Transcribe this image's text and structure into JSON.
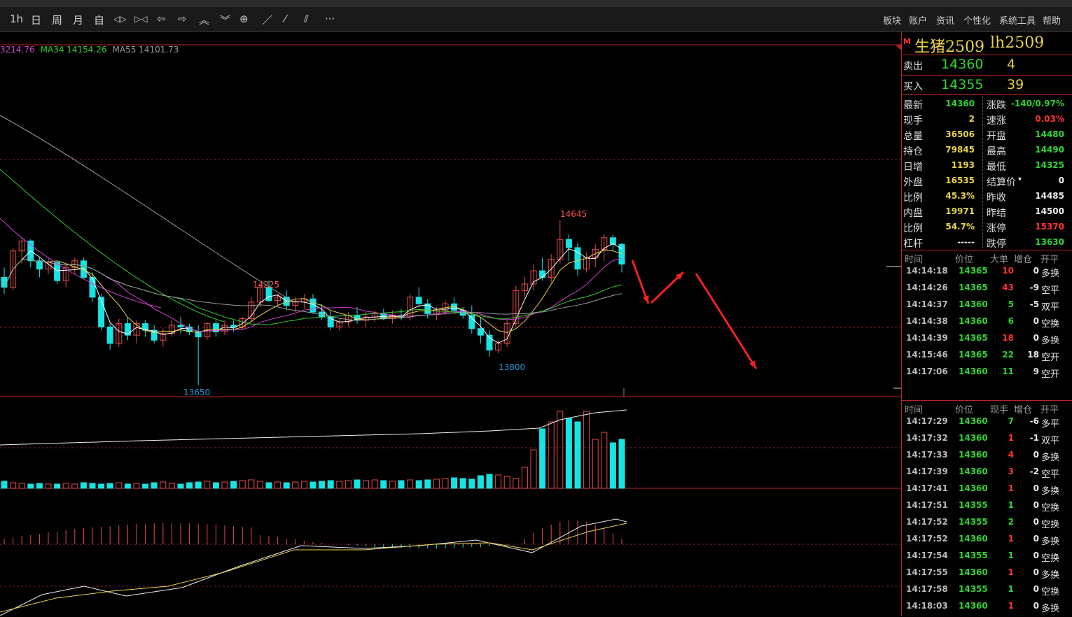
{
  "toolbar": {
    "buttons": [
      {
        "name": "period-1h-button",
        "label": "1h"
      },
      {
        "name": "period-day-button",
        "label": "日"
      },
      {
        "name": "period-week-button",
        "label": "周"
      },
      {
        "name": "period-month-button",
        "label": "月"
      },
      {
        "name": "custom-button",
        "label": "自"
      },
      {
        "name": "zoom-in-icon",
        "label": "◁▷"
      },
      {
        "name": "zoom-out-icon",
        "label": "▷◁"
      },
      {
        "name": "arrow-left-icon",
        "label": "⇦"
      },
      {
        "name": "arrow-right-icon",
        "label": "⇨"
      },
      {
        "name": "arrow-up-icon",
        "label": "︽"
      },
      {
        "name": "arrow-down-icon",
        "label": "︾"
      },
      {
        "name": "crosshair-icon",
        "label": "⊕"
      },
      {
        "name": "line-tool-icon",
        "label": "／"
      },
      {
        "name": "ray-tool-icon",
        "label": "⁄"
      },
      {
        "name": "channel-tool-icon",
        "label": "⫽"
      },
      {
        "name": "more-icon",
        "label": "···"
      }
    ],
    "menu": [
      "板块",
      "账户",
      "资讯",
      "个性化",
      "系统工具",
      "帮助"
    ]
  },
  "ma_legend": {
    "ma_first": "3214.76",
    "ma34": "MA34 14154.26",
    "ma55": "MA55 14101.73"
  },
  "price_labels": {
    "high": "14645",
    "low": "13650",
    "mid_high": "14225",
    "mid_low": "13800"
  },
  "contract": {
    "flag": "M",
    "name": "生猪2509",
    "code": "lh2509"
  },
  "ask": {
    "label": "卖出",
    "price": "14360",
    "volume": "4"
  },
  "bid": {
    "label": "买入",
    "price": "14355",
    "volume": "39"
  },
  "quote": [
    {
      "l1": "最新",
      "v1": "14360",
      "c1": "green",
      "l2": "涨跌",
      "v2": "-140/0.97%",
      "c2": "green"
    },
    {
      "l1": "现手",
      "v1": "2",
      "c1": "yellow",
      "l2": "速涨",
      "v2": "0.03%",
      "c2": "red"
    },
    {
      "l1": "总量",
      "v1": "36506",
      "c1": "yellow",
      "l2": "开盘",
      "v2": "14480",
      "c2": "green"
    },
    {
      "l1": "持仓",
      "v1": "79845",
      "c1": "yellow",
      "l2": "最高",
      "v2": "14490",
      "c2": "green"
    },
    {
      "l1": "日增",
      "v1": "1193",
      "c1": "yellow",
      "l2": "最低",
      "v2": "14325",
      "c2": "green"
    },
    {
      "l1": "外盘",
      "v1": "16535",
      "c1": "yellow",
      "l2": "结算价",
      "v2": "0",
      "c2": "white"
    },
    {
      "l1": "比例",
      "v1": "45.3%",
      "c1": "yellow",
      "l2": "昨收",
      "v2": "14485",
      "c2": "white"
    },
    {
      "l1": "内盘",
      "v1": "19971",
      "c1": "yellow",
      "l2": "昨结",
      "v2": "14500",
      "c2": "white"
    },
    {
      "l1": "比例",
      "v1": "54.7%",
      "c1": "yellow",
      "l2": "涨停",
      "v2": "15370",
      "c2": "red"
    },
    {
      "l1": "杠杆",
      "v1": "-----",
      "c1": "white",
      "l2": "跌停",
      "v2": "13630",
      "c2": "green"
    }
  ],
  "big_orders": {
    "headers": [
      "时间",
      "价位",
      "大单",
      "增仓",
      "开平"
    ],
    "rows": [
      {
        "t": "14:14:18",
        "p": "14365",
        "v": "10",
        "d": "0",
        "k": "多换",
        "vc": "red"
      },
      {
        "t": "14:14:26",
        "p": "14365",
        "v": "43",
        "d": "-9",
        "k": "空平",
        "vc": "red"
      },
      {
        "t": "14:14:37",
        "p": "14360",
        "v": "5",
        "d": "-5",
        "k": "双平",
        "vc": "green"
      },
      {
        "t": "14:14:38",
        "p": "14360",
        "v": "6",
        "d": "0",
        "k": "空换",
        "vc": "green"
      },
      {
        "t": "14:14:39",
        "p": "14365",
        "v": "18",
        "d": "0",
        "k": "多换",
        "vc": "red"
      },
      {
        "t": "14:15:46",
        "p": "14365",
        "v": "22",
        "d": "18",
        "k": "空开",
        "vc": "green"
      },
      {
        "t": "14:17:06",
        "p": "14360",
        "v": "11",
        "d": "9",
        "k": "空开",
        "vc": "green"
      }
    ]
  },
  "ticks": {
    "headers": [
      "时间",
      "价位",
      "现手",
      "增仓",
      "开平"
    ],
    "rows": [
      {
        "t": "14:17:29",
        "p": "14360",
        "v": "7",
        "d": "-6",
        "k": "多平",
        "vc": "green"
      },
      {
        "t": "14:17:32",
        "p": "14360",
        "v": "1",
        "d": "-1",
        "k": "双平",
        "vc": "red"
      },
      {
        "t": "14:17:33",
        "p": "14360",
        "v": "4",
        "d": "0",
        "k": "多换",
        "vc": "red"
      },
      {
        "t": "14:17:39",
        "p": "14360",
        "v": "3",
        "d": "-2",
        "k": "空平",
        "vc": "red"
      },
      {
        "t": "14:17:41",
        "p": "14360",
        "v": "1",
        "d": "0",
        "k": "多换",
        "vc": "red"
      },
      {
        "t": "14:17:51",
        "p": "14355",
        "v": "1",
        "d": "0",
        "k": "空换",
        "vc": "green"
      },
      {
        "t": "14:17:52",
        "p": "14355",
        "v": "2",
        "d": "0",
        "k": "空换",
        "vc": "green"
      },
      {
        "t": "14:17:52",
        "p": "14360",
        "v": "1",
        "d": "0",
        "k": "多换",
        "vc": "red"
      },
      {
        "t": "14:17:54",
        "p": "14355",
        "v": "1",
        "d": "0",
        "k": "空换",
        "vc": "green"
      },
      {
        "t": "14:17:55",
        "p": "14360",
        "v": "1",
        "d": "0",
        "k": "多换",
        "vc": "red"
      },
      {
        "t": "14:17:58",
        "p": "14355",
        "v": "1",
        "d": "0",
        "k": "空换",
        "vc": "green"
      },
      {
        "t": "14:18:03",
        "p": "14360",
        "v": "1",
        "d": "0",
        "k": "多换",
        "vc": "red"
      }
    ]
  },
  "colors": {
    "up": "#e84a4a",
    "down": "#17e3e3",
    "ma5": "#ffffff",
    "ma10": "#e8d24a",
    "ma20": "#d040d0",
    "ma34": "#33cc33",
    "ma55": "#999999",
    "grid": "#8b1a1a"
  }
}
